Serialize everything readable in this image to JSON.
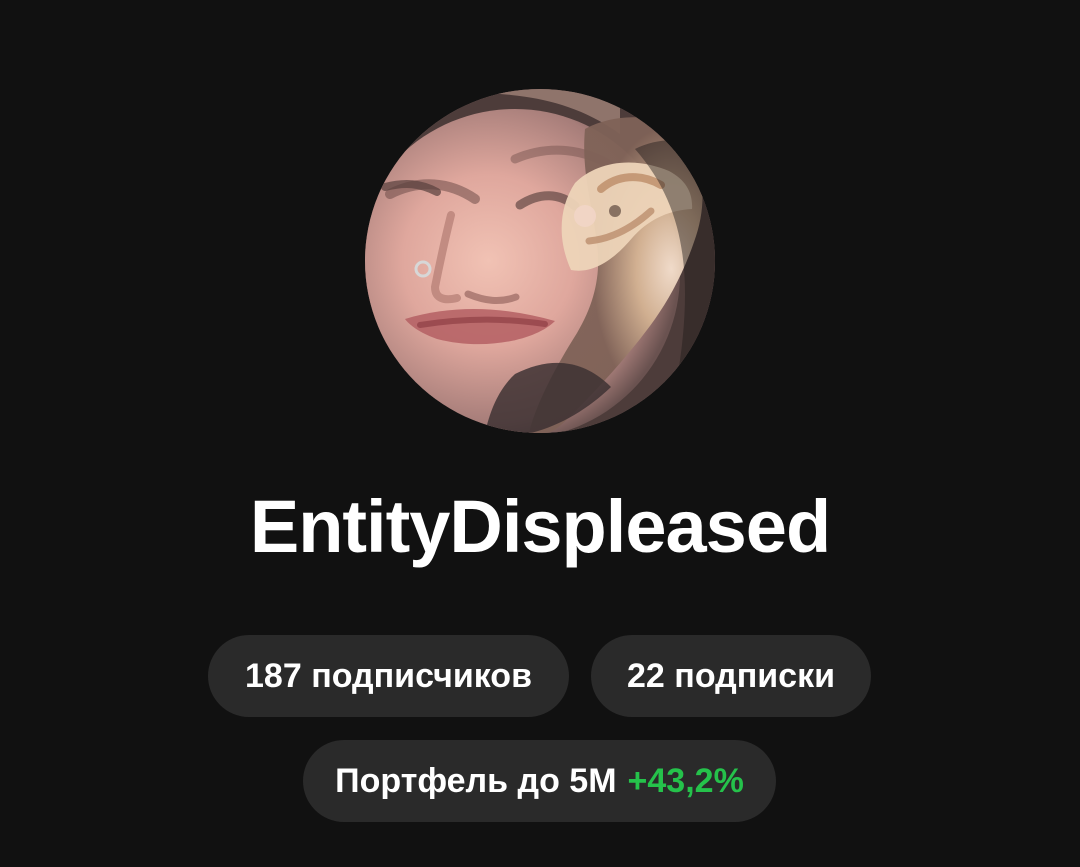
{
  "profile": {
    "avatar_icon": "profile-avatar",
    "username": "EntityDispleased",
    "followers_label": "187 подписчиков",
    "following_label": "22 подписки",
    "portfolio_prefix": "Портфель до 5М",
    "portfolio_change": "+43,2%",
    "accent_color": "#25c24b",
    "background_color": "#111111",
    "pill_color": "#2a2a2a"
  }
}
